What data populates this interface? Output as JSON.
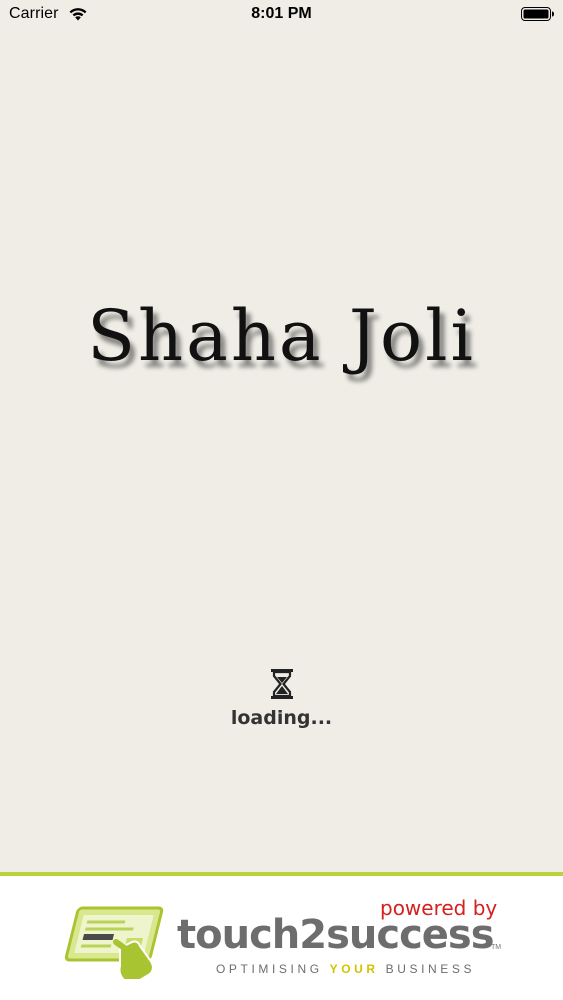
{
  "status_bar": {
    "carrier": "Carrier",
    "time": "8:01 PM",
    "wifi_icon": "wifi-icon",
    "battery_icon": "battery-icon"
  },
  "splash": {
    "brand_name": "Shaha Joli",
    "loading_icon": "hourglass-icon",
    "loading_text": "loading..."
  },
  "footer": {
    "powered_by": "powered by",
    "company": "touch2success",
    "trademark": "TM",
    "tagline_pre": "OPTIMISING ",
    "tagline_highlight": "YOUR",
    "tagline_post": " BUSINESS",
    "logo_icon": "tablet-hand-icon"
  },
  "colors": {
    "background": "#efede6",
    "footer_accent": "#b8d43a",
    "powered_by": "#d4201f",
    "tagline_highlight": "#d2c400",
    "company_text": "#6d6d6d"
  }
}
